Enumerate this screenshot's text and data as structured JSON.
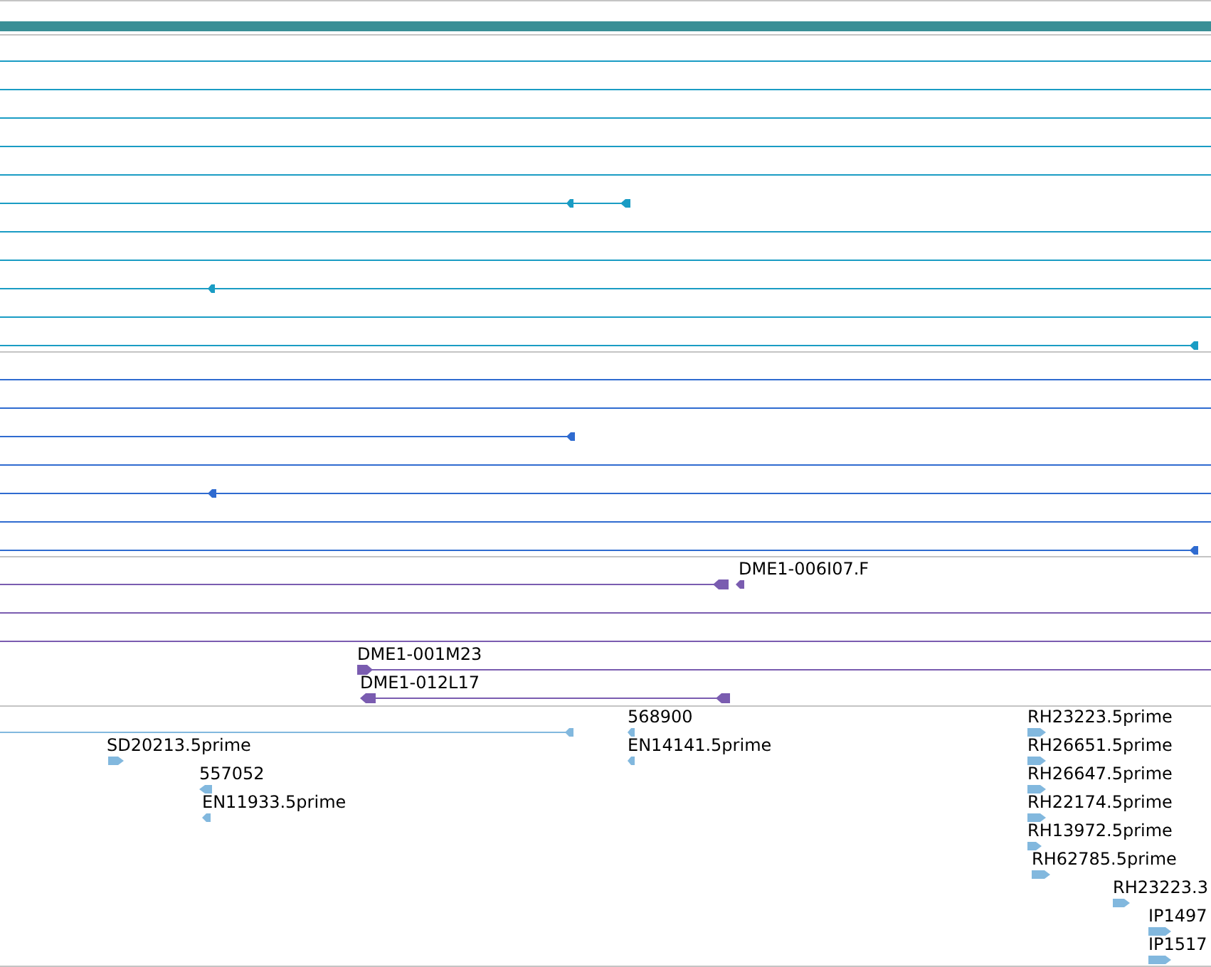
{
  "tracks": [
    {
      "color": "#3a8f96"
    },
    {
      "color": "#1a9cc4",
      "features": [
        {
          "reverse": true
        },
        {
          "reverse": true
        },
        {
          "reverse": true
        },
        {
          "reverse": true
        }
      ]
    },
    {
      "color": "#2f6bd0",
      "features": [
        {
          "reverse": true
        },
        {
          "reverse": true
        },
        {
          "reverse": true
        }
      ]
    },
    {
      "color": "#7a5cb0",
      "features": [
        {
          "reverse": true
        },
        {
          "label": "DME1-006I07.F",
          "reverse": true
        },
        {
          "label": "DME1-001M23",
          "reverse": false
        },
        {
          "label": "DME1-012L17",
          "reverse": true
        },
        {
          "reverse": true
        }
      ]
    },
    {
      "color": "#82b8de",
      "features": [
        {
          "reverse": true
        },
        {
          "label": "SD20213.5prime",
          "reverse": false
        },
        {
          "label": "557052",
          "reverse": true
        },
        {
          "label": "EN11933.5prime",
          "reverse": true
        },
        {
          "label": "568900",
          "reverse": true
        },
        {
          "label": "EN14141.5prime",
          "reverse": true
        },
        {
          "label": "RH23223.5prime",
          "reverse": false
        },
        {
          "label": "RH26651.5prime",
          "reverse": false
        },
        {
          "label": "RH26647.5prime",
          "reverse": false
        },
        {
          "label": "RH22174.5prime",
          "reverse": false
        },
        {
          "label": "RH13972.5prime",
          "reverse": false
        },
        {
          "label": "RH62785.5prime",
          "reverse": false
        },
        {
          "label": "RH23223.3",
          "reverse": false
        },
        {
          "label": "IP1497",
          "reverse": false
        },
        {
          "label": "IP1517",
          "reverse": false
        }
      ]
    }
  ]
}
